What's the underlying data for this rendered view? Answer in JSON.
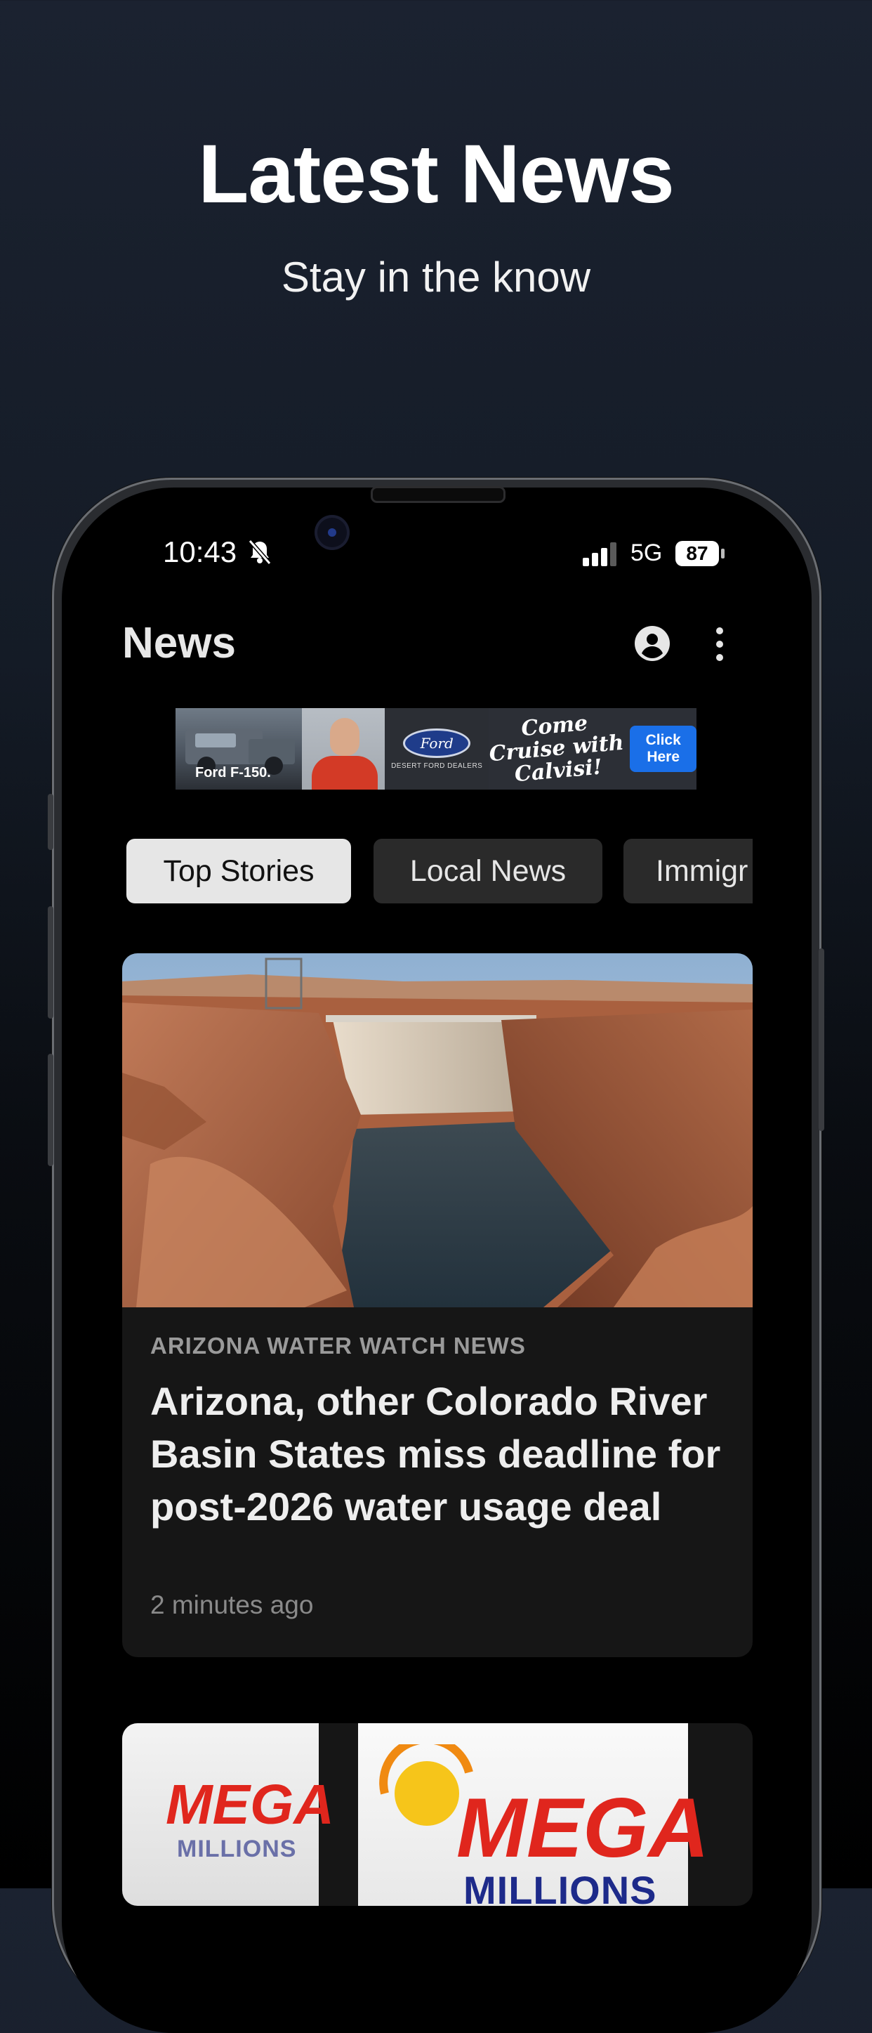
{
  "promo": {
    "title": "Latest News",
    "subtitle": "Stay in the know"
  },
  "status_bar": {
    "time": "10:43",
    "network": "5G",
    "battery": "87"
  },
  "app": {
    "title": "News"
  },
  "ad": {
    "truck_label": "Ford F-150.",
    "brand": "Ford",
    "dealer": "DESERT FORD DEALERS",
    "tagline": "Come Cruise with Calvisi!",
    "cta": "Click Here"
  },
  "tabs": [
    {
      "label": "Top Stories",
      "active": true
    },
    {
      "label": "Local News",
      "active": false
    },
    {
      "label": "Immigr",
      "active": false
    }
  ],
  "articles": [
    {
      "source": "ARIZONA WATER WATCH NEWS",
      "headline": "Arizona, other Colorado River Basin States miss deadline for post-2026 water usage deal",
      "time": "2 minutes ago"
    }
  ],
  "second_card": {
    "left_logo_top": "MEGA",
    "left_logo_bottom": "MILLIONS",
    "right_logo_top": "MEGA",
    "right_logo_bottom": "MILLIONS"
  },
  "colors": {
    "background_top": "#1b2230",
    "screen": "#000000",
    "card": "#161616",
    "tab_active": "#e6e6e6",
    "tab_idle": "#2a2a2a",
    "ad_cta": "#1a6fe8"
  }
}
